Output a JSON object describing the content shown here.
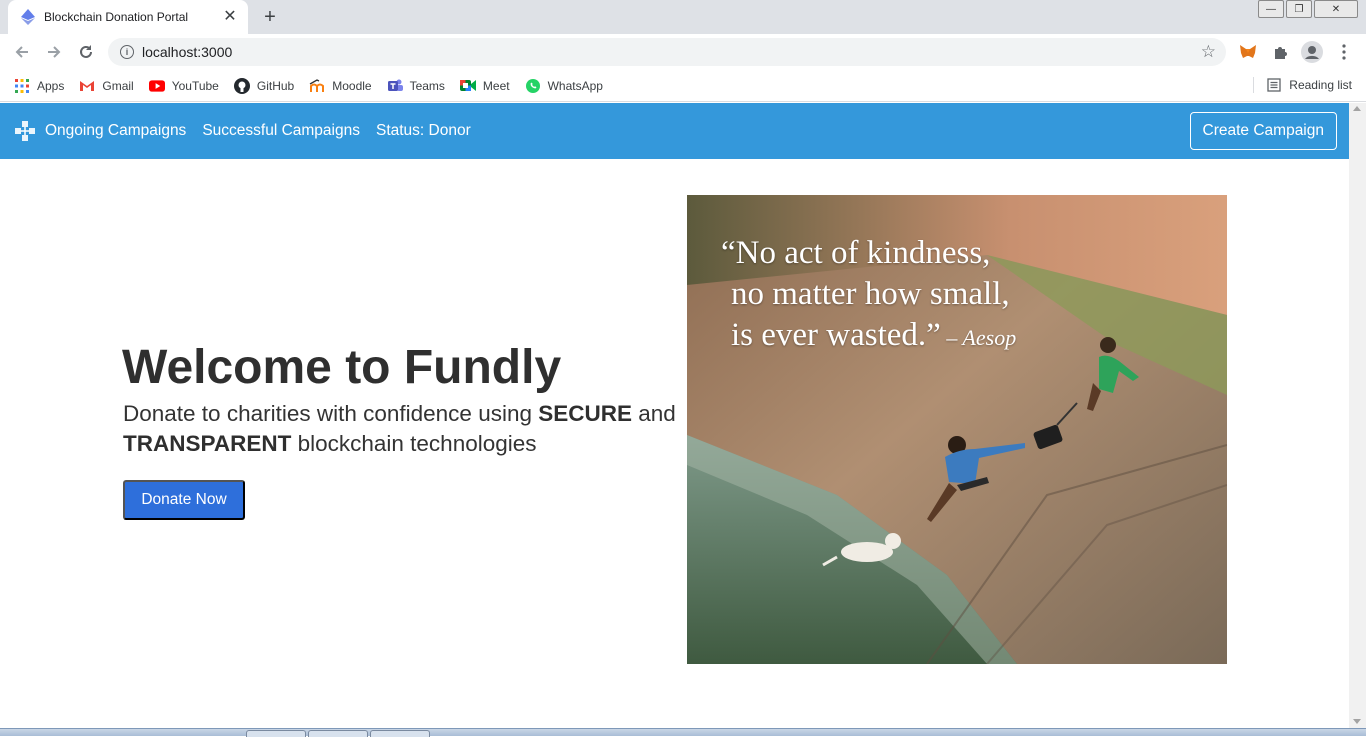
{
  "browser": {
    "tab_title": "Blockchain Donation Portal",
    "url": "localhost:3000",
    "bookmarks": [
      "Apps",
      "Gmail",
      "YouTube",
      "GitHub",
      "Moodle",
      "Teams",
      "Meet",
      "WhatsApp"
    ],
    "reading_list": "Reading list"
  },
  "navbar": {
    "links": [
      "Ongoing Campaigns",
      "Successful Campaigns",
      "Status: Donor"
    ],
    "create_button": "Create Campaign"
  },
  "hero": {
    "title": "Welcome to Fundly",
    "subtitle_parts": [
      "Donate to charities with confidence using ",
      "SECURE",
      " and ",
      "TRANSPARENT",
      " blockchain technologies"
    ],
    "donate_button": "Donate Now"
  },
  "image": {
    "quote_lines": [
      "“No act of kindness,",
      "no matter how small,",
      "is ever wasted.”"
    ],
    "author": " – Aesop"
  },
  "colors": {
    "navbar_bg": "#3498db",
    "donate_button_bg": "#2e6fdb"
  }
}
